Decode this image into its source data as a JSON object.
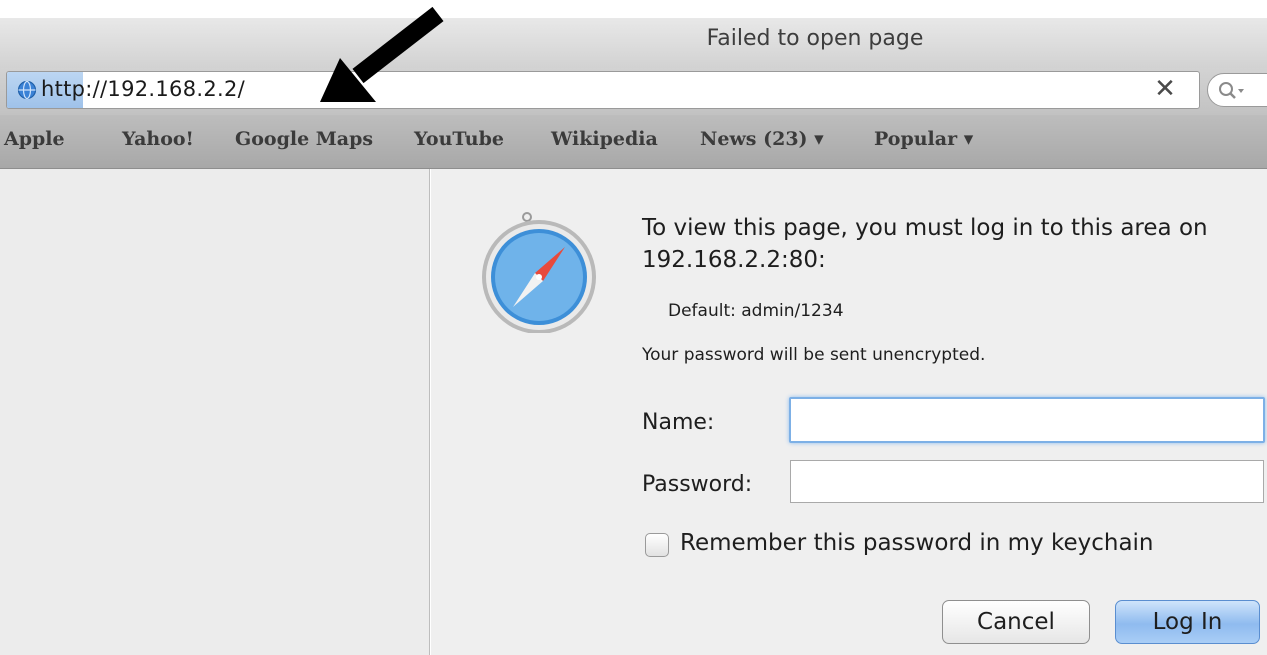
{
  "window": {
    "title": "Failed to open page"
  },
  "address_bar": {
    "url": "http://192.168.2.2/"
  },
  "bookmarks": [
    {
      "label": "Apple"
    },
    {
      "label": "Yahoo!"
    },
    {
      "label": "Google Maps"
    },
    {
      "label": "YouTube"
    },
    {
      "label": "Wikipedia"
    },
    {
      "label": "News (23) ▾"
    },
    {
      "label": "Popular ▾"
    }
  ],
  "auth_dialog": {
    "message": "To view this page, you must log in to this area on 192.168.2.2:80:",
    "realm": "Default: admin/1234",
    "warning": "Your password will be sent unencrypted.",
    "name_label": "Name:",
    "name_value": "",
    "password_label": "Password:",
    "password_value": "",
    "remember_label": "Remember this password in my keychain",
    "remember_checked": false,
    "cancel_label": "Cancel",
    "login_label": "Log In"
  },
  "colors": {
    "accent_focus": "#7db0e6",
    "default_button": "#8fbbef",
    "annotation_arrow": "#000000"
  },
  "icons": {
    "page": "globe-icon",
    "clear": "clear-icon",
    "search": "search-icon",
    "app": "safari-compass-icon",
    "annotation": "arrow-icon"
  }
}
